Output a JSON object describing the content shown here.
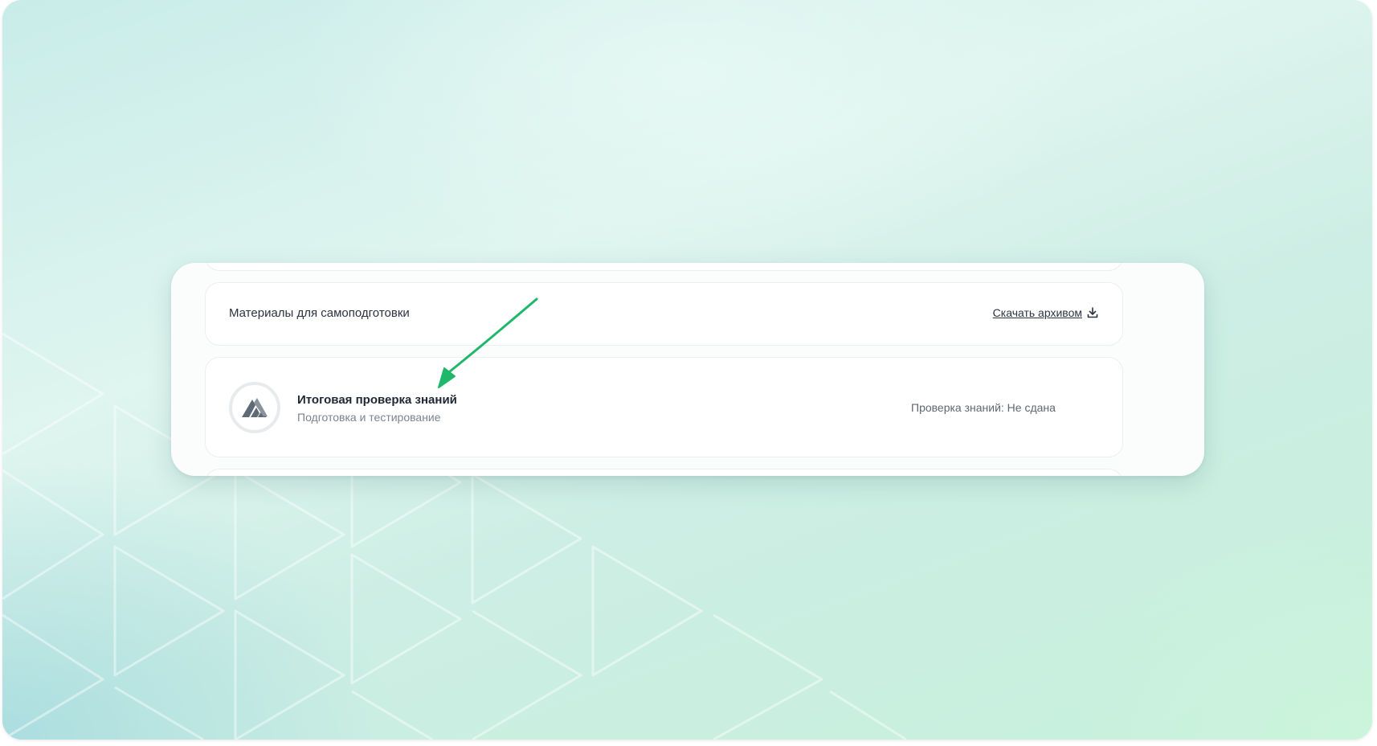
{
  "materials": {
    "title": "Материалы для самоподготовки",
    "download_label": "Скачать архивом",
    "download_icon": "download-icon"
  },
  "test_item": {
    "title": "Итоговая проверка знаний",
    "subtitle": "Подготовка и тестирование",
    "status": "Проверка знаний: Не сдана",
    "icon": "mountain-logo-icon"
  },
  "colors": {
    "accent_arrow": "#1fb86a",
    "text_primary": "#1f2733",
    "text_secondary": "#7b848f"
  }
}
